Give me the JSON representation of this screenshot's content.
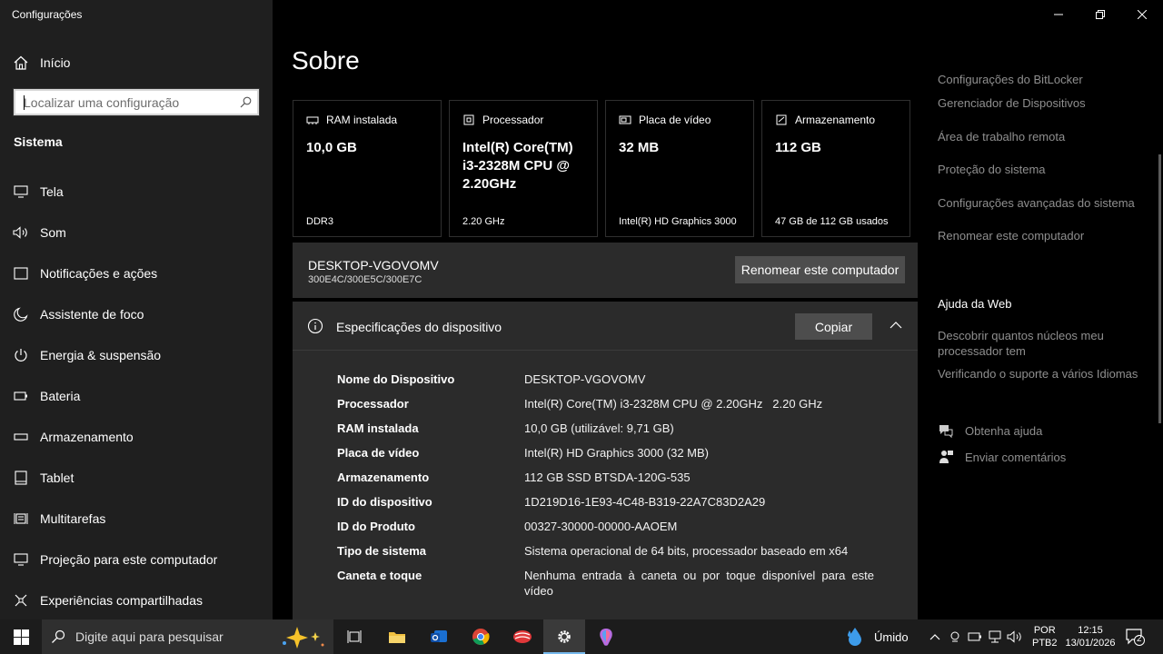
{
  "window": {
    "title": "Configurações"
  },
  "sidebar": {
    "home_label": "Início",
    "search_placeholder": "Localizar uma configuração",
    "section_title": "Sistema",
    "items": [
      {
        "label": "Tela",
        "icon": "monitor-icon"
      },
      {
        "label": "Som",
        "icon": "speaker-icon"
      },
      {
        "label": "Notificações e ações",
        "icon": "notification-icon"
      },
      {
        "label": "Assistente de foco",
        "icon": "moon-icon"
      },
      {
        "label": "Energia & suspensão",
        "icon": "power-icon"
      },
      {
        "label": "Bateria",
        "icon": "battery-icon"
      },
      {
        "label": "Armazenamento",
        "icon": "storage-icon"
      },
      {
        "label": "Tablet",
        "icon": "tablet-icon"
      },
      {
        "label": "Multitarefas",
        "icon": "multitask-icon"
      },
      {
        "label": "Projeção para este computador",
        "icon": "projection-icon"
      },
      {
        "label": "Experiências compartilhadas",
        "icon": "shared-icon"
      }
    ]
  },
  "main": {
    "title": "Sobre",
    "cards": [
      {
        "label": "RAM instalada",
        "value": "10,0 GB",
        "sub": "DDR3",
        "icon": "ram-icon"
      },
      {
        "label": "Processador",
        "value": "Intel(R) Core(TM) i3-2328M CPU @ 2.20GHz",
        "sub": "2.20 GHz",
        "icon": "cpu-icon"
      },
      {
        "label": "Placa de vídeo",
        "value": "32 MB",
        "sub": "Intel(R) HD Graphics 3000",
        "icon": "gpu-icon"
      },
      {
        "label": "Armazenamento",
        "value": "112 GB",
        "sub": "47 GB de 112 GB usados",
        "icon": "drive-icon"
      }
    ],
    "pc": {
      "name": "DESKTOP-VGOVOMV",
      "code": "300E4C/300E5C/300E7C",
      "rename_label": "Renomear este computador"
    },
    "specs": {
      "title": "Especificações do dispositivo",
      "copy_label": "Copiar",
      "rows": [
        {
          "key": "Nome do Dispositivo",
          "value": "DESKTOP-VGOVOMV"
        },
        {
          "key": "Processador",
          "value": "Intel(R) Core(TM) i3-2328M CPU @ 2.20GHz   2.20 GHz"
        },
        {
          "key": "RAM instalada",
          "value": "10,0 GB (utilizável: 9,71 GB)"
        },
        {
          "key": "Placa de vídeo",
          "value": "Intel(R) HD Graphics 3000 (32 MB)"
        },
        {
          "key": "Armazenamento",
          "value": "112 GB SSD BTSDA-120G-535"
        },
        {
          "key": "ID do dispositivo",
          "value": "1D219D16-1E93-4C48-B319-22A7C83D2A29"
        },
        {
          "key": "ID do Produto",
          "value": "00327-30000-00000-AAOEM"
        },
        {
          "key": "Tipo de sistema",
          "value": "Sistema operacional de 64 bits, processador baseado em x64"
        },
        {
          "key": "Caneta e toque",
          "value": "Nenhuma entrada à caneta ou por toque disponível para este vídeo"
        }
      ]
    }
  },
  "related": {
    "links": [
      "Configurações do BitLocker",
      "Gerenciador de Dispositivos",
      "Área de trabalho remota",
      "Proteção do sistema",
      "Configurações avançadas do sistema",
      "Renomear este computador"
    ],
    "help_title": "Ajuda da Web",
    "help_links": [
      "Descobrir quantos núcleos meu processador tem",
      "Verificando o suporte a vários Idiomas"
    ],
    "get_help": "Obtenha ajuda",
    "feedback": "Enviar comentários"
  },
  "taskbar": {
    "search_placeholder": "Digite aqui para pesquisar",
    "weather": "Úmido",
    "lang_line1": "POR",
    "lang_line2": "PTB2",
    "time": "12:15",
    "date": "13/01/2026",
    "notifications": "2",
    "accent": "#76b9ed"
  }
}
